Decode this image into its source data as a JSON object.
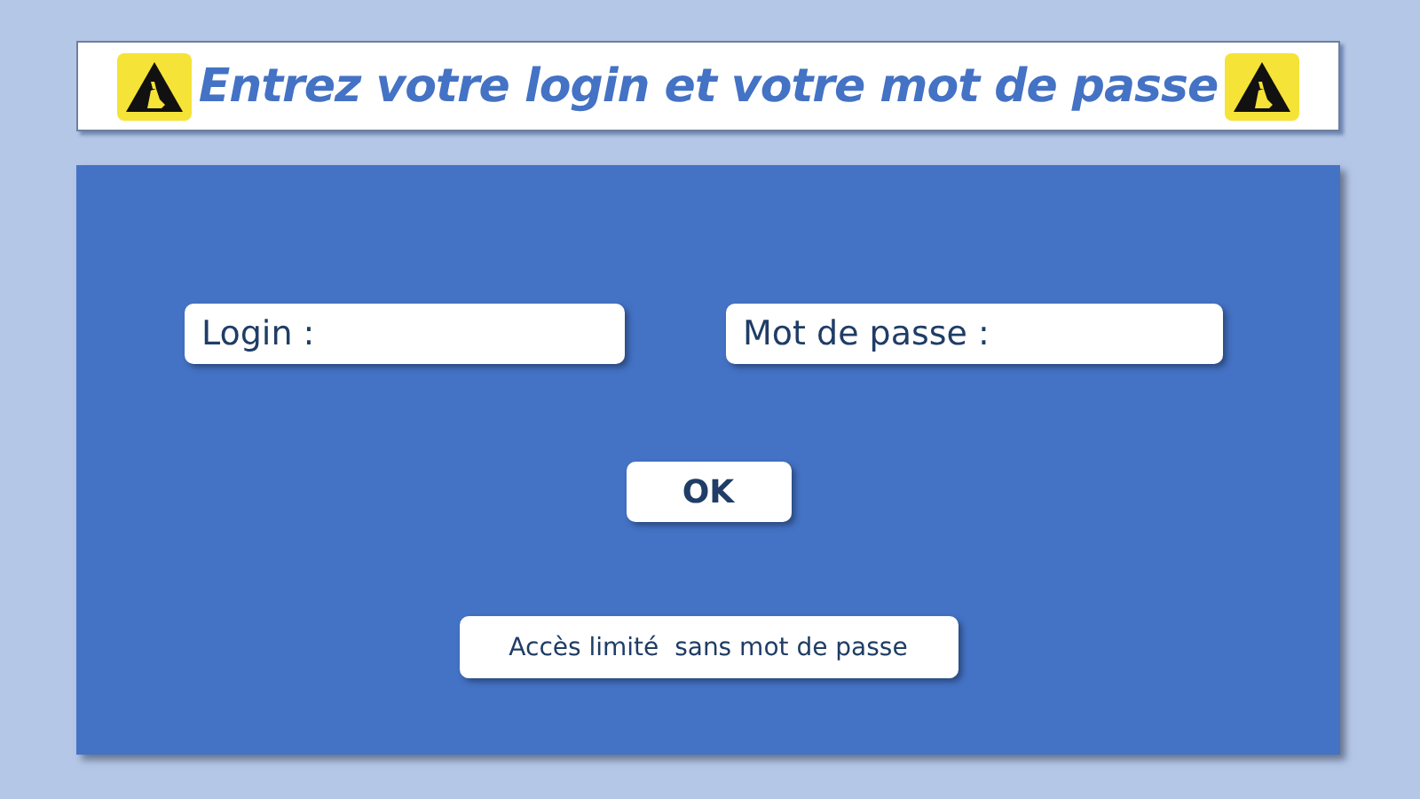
{
  "header": {
    "title": "Entrez votre login et votre mot de passe"
  },
  "fields": [
    {
      "label": "Login :"
    },
    {
      "label": "Mot de passe :"
    }
  ],
  "buttons": [
    {
      "kind": "primary",
      "label": "OK"
    },
    {
      "kind": "secondary",
      "label": "Accès limité  sans mot de passe"
    }
  ]
}
